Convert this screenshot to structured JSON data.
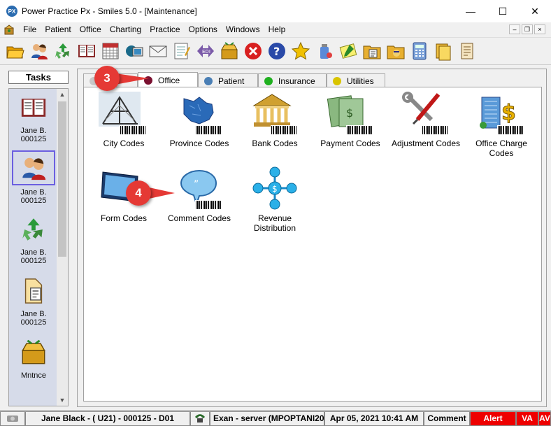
{
  "window": {
    "title": "Power Practice Px - Smiles 5.0 - [Maintenance]",
    "app_icon_text": "PX",
    "minimize_glyph": "—",
    "maximize_glyph": "☐",
    "close_glyph": "✕"
  },
  "menu": {
    "items": [
      {
        "label": "File"
      },
      {
        "label": "Patient"
      },
      {
        "label": "Office"
      },
      {
        "label": "Charting"
      },
      {
        "label": "Practice"
      },
      {
        "label": "Options"
      },
      {
        "label": "Windows"
      },
      {
        "label": "Help"
      }
    ],
    "mdi_min": "–",
    "mdi_restore": "❐",
    "mdi_close": "×"
  },
  "toolbar": {
    "icons": [
      "folder-open-icon",
      "patients-icon",
      "recycle-icon",
      "book-icon",
      "calendar-icon",
      "monitor-icon",
      "envelope-icon",
      "notepad-icon",
      "edi-icon",
      "treasure-icon",
      "cancel-icon",
      "help-icon",
      "star-icon",
      "bottle-icon",
      "note-icon",
      "folder-doc-icon",
      "folder-face-icon",
      "calculator-icon",
      "folders-icon",
      "scroll-icon"
    ]
  },
  "tasks": {
    "header": "Tasks",
    "items": [
      {
        "line1": "Jane B.",
        "line2": "000125",
        "icon": "book-icon"
      },
      {
        "line1": "Jane B.",
        "line2": "000125",
        "icon": "patients-icon"
      },
      {
        "line1": "Jane B.",
        "line2": "000125",
        "icon": "recycle-icon"
      },
      {
        "line1": "Jane B.",
        "line2": "000125",
        "icon": "document-icon"
      },
      {
        "line1": "Mntnce",
        "line2": "",
        "icon": "treasure-icon"
      }
    ]
  },
  "tabs": [
    {
      "label": "",
      "color": "#c8c8c8"
    },
    {
      "label": "Office",
      "color": "#7a1030"
    },
    {
      "label": "Patient",
      "color": "#4a7fb5"
    },
    {
      "label": "Insurance",
      "color": "#1fb01f"
    },
    {
      "label": "Utilities",
      "color": "#d9c400"
    }
  ],
  "codes": [
    {
      "label": "City Codes"
    },
    {
      "label": "Province Codes"
    },
    {
      "label": "Bank Codes"
    },
    {
      "label": "Payment Codes"
    },
    {
      "label": "Adjustment Codes"
    },
    {
      "label": "Office Charge Codes"
    },
    {
      "label": "Form Codes"
    },
    {
      "label": "Comment Codes"
    },
    {
      "label": "Revenue Distribution"
    }
  ],
  "callouts": {
    "step3": "3",
    "step4": "4"
  },
  "status": {
    "patient": "Jane Black - ( U21) - 000125 - D01",
    "exam": "Exan - server (MPOPTANI20",
    "datetime": "Apr 05, 2021 10:41 AM",
    "comment": "Comment",
    "alert": "Alert",
    "va": "VA",
    "av": "AV"
  }
}
